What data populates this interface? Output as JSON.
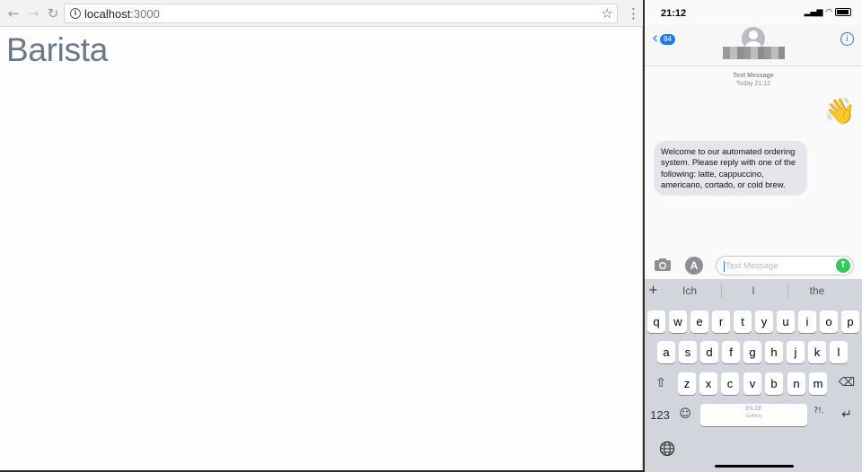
{
  "browser": {
    "url_host": "localhost",
    "url_port": ":3000",
    "page_heading": "Barista",
    "icons": [
      "back-arrow-icon",
      "forward-arrow-icon",
      "reload-icon",
      "info-icon",
      "star-icon",
      "menu-dots-icon"
    ]
  },
  "phone": {
    "status": {
      "time": "21:12"
    },
    "header": {
      "back_count": "84"
    },
    "thread": {
      "kind": "Text Message",
      "date": "Today 21:12",
      "sent_emoji": "👋",
      "received_message": "Welcome to our automated ordering system. Please reply with one of the following: latte, cappuccino, americano, cortado, or cold brew."
    },
    "compose": {
      "placeholder": "Text Message"
    },
    "keyboard": {
      "predictions": [
        "Ich",
        "I",
        "the"
      ],
      "row1": [
        "q",
        "w",
        "e",
        "r",
        "t",
        "y",
        "u",
        "i",
        "o",
        "p"
      ],
      "row2": [
        "a",
        "s",
        "d",
        "f",
        "g",
        "h",
        "j",
        "k",
        "l"
      ],
      "row3": [
        "z",
        "x",
        "c",
        "v",
        "b",
        "n",
        "m"
      ],
      "numbers_key": "123",
      "space_lang": "EN DE",
      "space_brand": "SwiftKey",
      "punct_key": "?!."
    }
  }
}
